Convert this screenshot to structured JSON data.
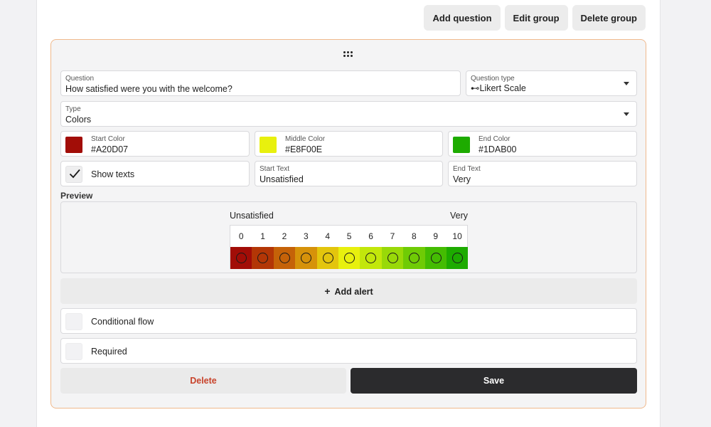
{
  "toolbar": {
    "add_question": "Add question",
    "edit_group": "Edit group",
    "delete_group": "Delete group"
  },
  "question": {
    "label": "Question",
    "value": "How satisfied were you with the welcome?"
  },
  "question_type": {
    "label": "Question type",
    "value": "⊷Likert Scale"
  },
  "type": {
    "label": "Type",
    "value": "Colors"
  },
  "start_color": {
    "label": "Start Color",
    "value": "#A20D07",
    "color": "#A20D07"
  },
  "middle_color": {
    "label": "Middle Color",
    "value": "#E8F00E",
    "color": "#E8F00E"
  },
  "end_color": {
    "label": "End Color",
    "value": "#1DAB00",
    "color": "#1DAB00"
  },
  "show_texts": {
    "label": "Show texts",
    "checked": true
  },
  "start_text": {
    "label": "Start Text",
    "value": "Unsatisfied"
  },
  "end_text": {
    "label": "End Text",
    "value": "Very"
  },
  "preview": {
    "label": "Preview",
    "start_text": "Unsatisfied",
    "end_text": "Very",
    "scale": [
      {
        "n": "0",
        "color": "#A20D07"
      },
      {
        "n": "1",
        "color": "#B33606"
      },
      {
        "n": "2",
        "color": "#C56208"
      },
      {
        "n": "3",
        "color": "#D6920A"
      },
      {
        "n": "4",
        "color": "#E3C50D"
      },
      {
        "n": "5",
        "color": "#E8F00E"
      },
      {
        "n": "6",
        "color": "#C2E70B"
      },
      {
        "n": "7",
        "color": "#99D908"
      },
      {
        "n": "8",
        "color": "#6FCB05"
      },
      {
        "n": "9",
        "color": "#44BC02"
      },
      {
        "n": "10",
        "color": "#1DAB00"
      }
    ]
  },
  "add_alert": {
    "label": "Add alert"
  },
  "conditional_flow": {
    "label": "Conditional flow",
    "checked": false
  },
  "required": {
    "label": "Required",
    "checked": false
  },
  "actions": {
    "delete": "Delete",
    "save": "Save"
  }
}
